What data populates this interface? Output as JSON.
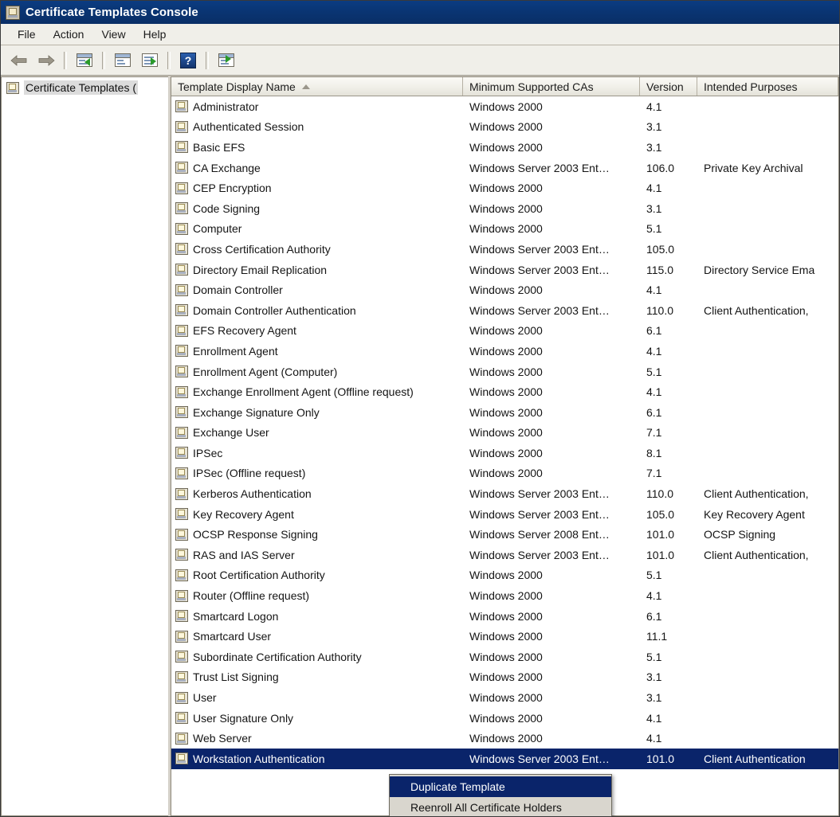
{
  "window": {
    "title": "Certificate Templates Console",
    "icon": "certificate-template-icon"
  },
  "menubar": {
    "items": [
      {
        "label": "File"
      },
      {
        "label": "Action"
      },
      {
        "label": "View"
      },
      {
        "label": "Help"
      }
    ]
  },
  "toolbar": {
    "buttons": [
      {
        "name": "back-button",
        "icon": "arrow-left-icon"
      },
      {
        "name": "forward-button",
        "icon": "arrow-right-icon"
      },
      {
        "name": "show-hide-tree-button",
        "icon": "console-tree-icon"
      },
      {
        "name": "properties-button",
        "icon": "properties-window-icon"
      },
      {
        "name": "export-list-button",
        "icon": "export-list-icon"
      },
      {
        "name": "help-button",
        "icon": "question-mark-icon",
        "label": "?"
      },
      {
        "name": "show-action-pane-button",
        "icon": "action-pane-icon"
      }
    ]
  },
  "tree": {
    "nodes": [
      {
        "label": "Certificate Templates (",
        "icon": "certificate-template-icon",
        "selected": true
      }
    ]
  },
  "list": {
    "columns": [
      {
        "key": "name",
        "label": "Template Display Name",
        "sorted": "asc"
      },
      {
        "key": "cas",
        "label": "Minimum Supported CAs"
      },
      {
        "key": "version",
        "label": "Version"
      },
      {
        "key": "purposes",
        "label": "Intended Purposes"
      }
    ],
    "rows": [
      {
        "name": "Administrator",
        "cas": "Windows 2000",
        "version": "4.1",
        "purposes": ""
      },
      {
        "name": "Authenticated Session",
        "cas": "Windows 2000",
        "version": "3.1",
        "purposes": ""
      },
      {
        "name": "Basic EFS",
        "cas": "Windows 2000",
        "version": "3.1",
        "purposes": ""
      },
      {
        "name": "CA Exchange",
        "cas": "Windows Server 2003 Ent…",
        "version": "106.0",
        "purposes": "Private Key Archival"
      },
      {
        "name": "CEP Encryption",
        "cas": "Windows 2000",
        "version": "4.1",
        "purposes": ""
      },
      {
        "name": "Code Signing",
        "cas": "Windows 2000",
        "version": "3.1",
        "purposes": ""
      },
      {
        "name": "Computer",
        "cas": "Windows 2000",
        "version": "5.1",
        "purposes": ""
      },
      {
        "name": "Cross Certification Authority",
        "cas": "Windows Server 2003 Ent…",
        "version": "105.0",
        "purposes": ""
      },
      {
        "name": "Directory Email Replication",
        "cas": "Windows Server 2003 Ent…",
        "version": "115.0",
        "purposes": "Directory Service Ema"
      },
      {
        "name": "Domain Controller",
        "cas": "Windows 2000",
        "version": "4.1",
        "purposes": ""
      },
      {
        "name": "Domain Controller Authentication",
        "cas": "Windows Server 2003 Ent…",
        "version": "110.0",
        "purposes": "Client Authentication,"
      },
      {
        "name": "EFS Recovery Agent",
        "cas": "Windows 2000",
        "version": "6.1",
        "purposes": ""
      },
      {
        "name": "Enrollment Agent",
        "cas": "Windows 2000",
        "version": "4.1",
        "purposes": ""
      },
      {
        "name": "Enrollment Agent (Computer)",
        "cas": "Windows 2000",
        "version": "5.1",
        "purposes": ""
      },
      {
        "name": "Exchange Enrollment Agent (Offline request)",
        "cas": "Windows 2000",
        "version": "4.1",
        "purposes": ""
      },
      {
        "name": "Exchange Signature Only",
        "cas": "Windows 2000",
        "version": "6.1",
        "purposes": ""
      },
      {
        "name": "Exchange User",
        "cas": "Windows 2000",
        "version": "7.1",
        "purposes": ""
      },
      {
        "name": "IPSec",
        "cas": "Windows 2000",
        "version": "8.1",
        "purposes": ""
      },
      {
        "name": "IPSec (Offline request)",
        "cas": "Windows 2000",
        "version": "7.1",
        "purposes": ""
      },
      {
        "name": "Kerberos Authentication",
        "cas": "Windows Server 2003 Ent…",
        "version": "110.0",
        "purposes": "Client Authentication,"
      },
      {
        "name": "Key Recovery Agent",
        "cas": "Windows Server 2003 Ent…",
        "version": "105.0",
        "purposes": "Key Recovery Agent"
      },
      {
        "name": "OCSP Response Signing",
        "cas": "Windows Server 2008 Ent…",
        "version": "101.0",
        "purposes": "OCSP Signing"
      },
      {
        "name": "RAS and IAS Server",
        "cas": "Windows Server 2003 Ent…",
        "version": "101.0",
        "purposes": "Client Authentication,"
      },
      {
        "name": "Root Certification Authority",
        "cas": "Windows 2000",
        "version": "5.1",
        "purposes": ""
      },
      {
        "name": "Router (Offline request)",
        "cas": "Windows 2000",
        "version": "4.1",
        "purposes": ""
      },
      {
        "name": "Smartcard Logon",
        "cas": "Windows 2000",
        "version": "6.1",
        "purposes": ""
      },
      {
        "name": "Smartcard User",
        "cas": "Windows 2000",
        "version": "11.1",
        "purposes": ""
      },
      {
        "name": "Subordinate Certification Authority",
        "cas": "Windows 2000",
        "version": "5.1",
        "purposes": ""
      },
      {
        "name": "Trust List Signing",
        "cas": "Windows 2000",
        "version": "3.1",
        "purposes": ""
      },
      {
        "name": "User",
        "cas": "Windows 2000",
        "version": "3.1",
        "purposes": ""
      },
      {
        "name": "User Signature Only",
        "cas": "Windows 2000",
        "version": "4.1",
        "purposes": ""
      },
      {
        "name": "Web Server",
        "cas": "Windows 2000",
        "version": "4.1",
        "purposes": ""
      },
      {
        "name": "Workstation Authentication",
        "cas": "Windows Server 2003 Ent…",
        "version": "101.0",
        "purposes": "Client Authentication",
        "selected": true
      }
    ]
  },
  "context_menu": {
    "items": [
      {
        "label": "Duplicate Template",
        "highlighted": true
      },
      {
        "label": "Reenroll All Certificate Holders",
        "highlighted": false
      }
    ]
  },
  "colors": {
    "titlebar": "#0a3573",
    "selection": "#0a246a",
    "chrome": "#f0efe9",
    "accent_green": "#2a9a2a"
  }
}
